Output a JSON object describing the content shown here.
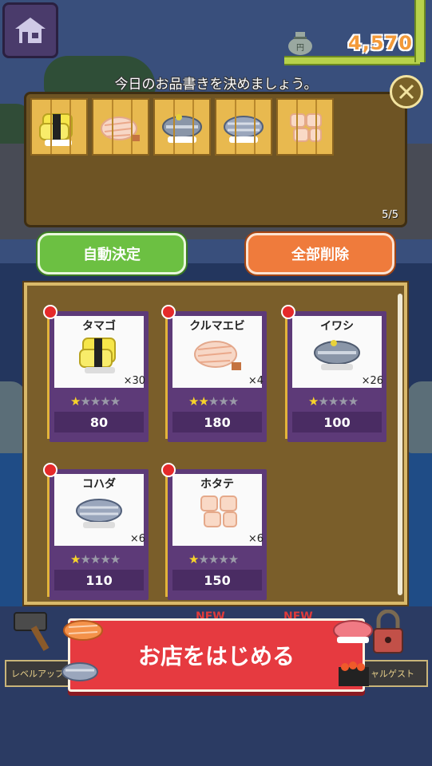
{
  "header": {
    "coins": "4,570",
    "menu_title": "今日のお品書きを決めましょう。"
  },
  "selected": {
    "items": [
      "tamago",
      "kurumaebi",
      "iwashi",
      "kohada",
      "hotate"
    ],
    "count": "5/5"
  },
  "actions": {
    "auto_label": "自動決定",
    "clear_label": "全部削除"
  },
  "inventory": [
    {
      "name": "タマゴ",
      "qty": "×30",
      "stars": 1,
      "price": "80",
      "icon": "tamago-sushi-icon"
    },
    {
      "name": "クルマエビ",
      "qty": "×4",
      "stars": 2,
      "price": "180",
      "icon": "shrimp-sushi-icon"
    },
    {
      "name": "イワシ",
      "qty": "×26",
      "stars": 1,
      "price": "100",
      "icon": "sardine-sushi-icon"
    },
    {
      "name": "コハダ",
      "qty": "×6",
      "stars": 1,
      "price": "110",
      "icon": "gizzard-shad-sushi-icon"
    },
    {
      "name": "ホタテ",
      "qty": "×6",
      "stars": 1,
      "price": "150",
      "icon": "scallop-sushi-icon"
    }
  ],
  "bottom": {
    "start_label": "お店をはじめる",
    "level_up_label": "レベルアップ",
    "special_guest_label": "ャルゲスト",
    "new_badge": "NEW"
  },
  "colors": {
    "accent_green": "#6cc042",
    "accent_orange": "#ef7b3c",
    "start_red": "#e63a40",
    "card_purple": "#5d3a78",
    "coin_orange": "#f39a3a"
  }
}
